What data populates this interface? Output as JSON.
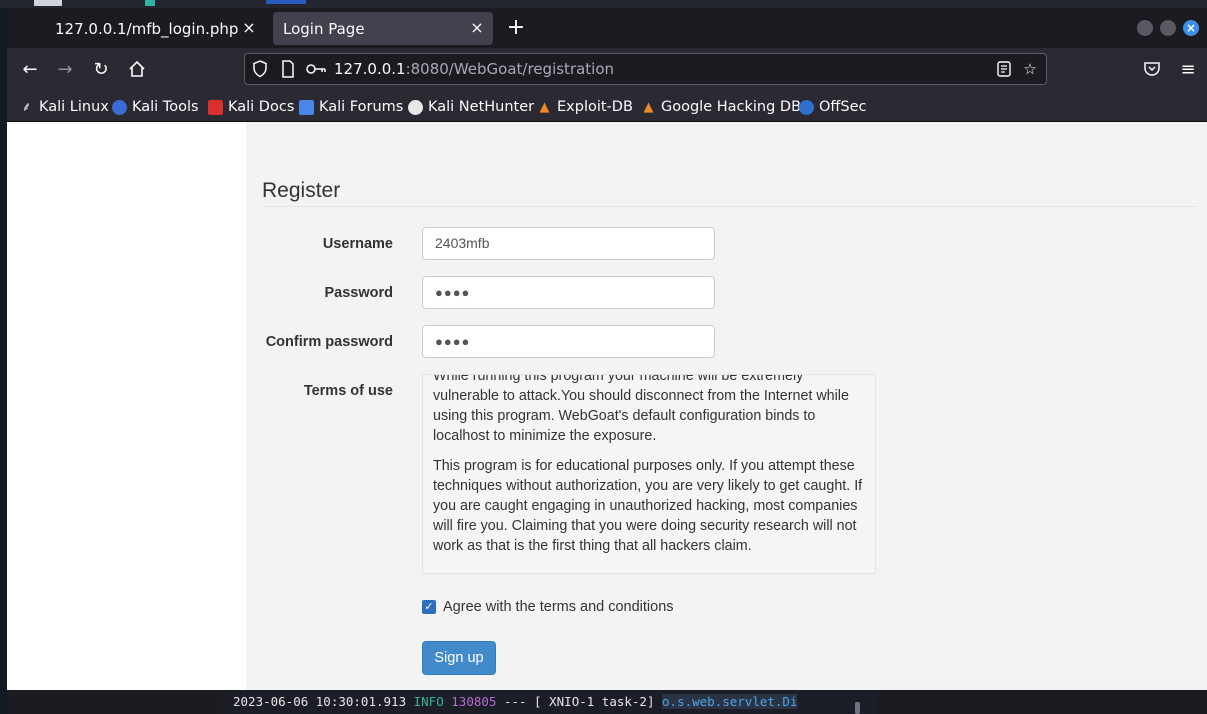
{
  "browser": {
    "tabs": [
      {
        "label": "127.0.0.1/mfb_login.php",
        "active": false
      },
      {
        "label": "Login Page",
        "active": true
      }
    ],
    "new_tab": "+",
    "url_host": "127.0.0.1",
    "url_rest": ":8080/WebGoat/registration",
    "bookmarks": [
      {
        "label": "Kali Linux",
        "icon": "kali-dragon-icon"
      },
      {
        "label": "Kali Tools",
        "icon": "kali-tools-icon"
      },
      {
        "label": "Kali Docs",
        "icon": "kali-docs-icon"
      },
      {
        "label": "Kali Forums",
        "icon": "kali-forums-icon"
      },
      {
        "label": "Kali NetHunter",
        "icon": "nethunter-icon"
      },
      {
        "label": "Exploit-DB",
        "icon": "exploit-db-icon"
      },
      {
        "label": "Google Hacking DB",
        "icon": "ghdb-icon"
      },
      {
        "label": "OffSec",
        "icon": "offsec-icon"
      }
    ]
  },
  "form": {
    "title": "Register",
    "username_label": "Username",
    "username_value": "2403mfb",
    "password_label": "Password",
    "password_value": "●●●●",
    "confirm_label": "Confirm password",
    "confirm_value": "●●●●",
    "terms_label": "Terms of use",
    "terms_text": [
      "While running this program your machine will be extremely vulnerable to attack.You should disconnect from the Internet while using this program. WebGoat's default configuration binds to localhost to minimize the exposure.",
      "This program is for educational purposes only. If you attempt these techniques without authorization, you are very likely to get caught. If you are caught engaging in unauthorized hacking, most companies will fire you. Claiming that you were doing security research will not work as that is the first thing that all hackers claim."
    ],
    "agree_label": "Agree with the terms and conditions",
    "agree_checked": true,
    "signup_label": "Sign up"
  },
  "terminal": {
    "timestamp": "2023-06-06 10:30:01.913",
    "level": "INFO",
    "pid": "130805",
    "sep": "--- [",
    "thread": "XNIO-1 task-2]",
    "logger": "o.s.web.servlet.Di"
  }
}
